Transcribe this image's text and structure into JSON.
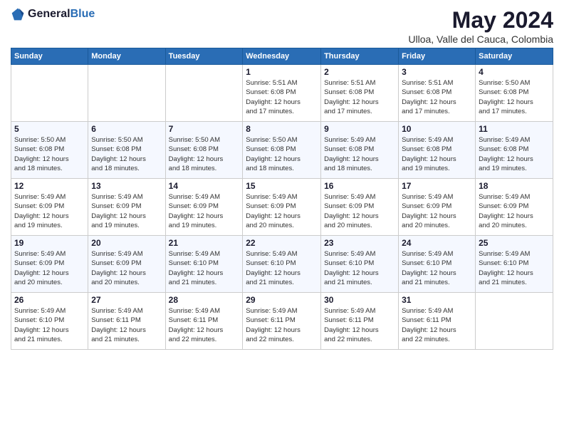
{
  "app": {
    "logo_general": "General",
    "logo_blue": "Blue",
    "title": "May 2024",
    "subtitle": "Ulloa, Valle del Cauca, Colombia"
  },
  "calendar": {
    "headers": [
      "Sunday",
      "Monday",
      "Tuesday",
      "Wednesday",
      "Thursday",
      "Friday",
      "Saturday"
    ],
    "rows": [
      [
        {
          "day": "",
          "info": ""
        },
        {
          "day": "",
          "info": ""
        },
        {
          "day": "",
          "info": ""
        },
        {
          "day": "1",
          "info": "Sunrise: 5:51 AM\nSunset: 6:08 PM\nDaylight: 12 hours\nand 17 minutes."
        },
        {
          "day": "2",
          "info": "Sunrise: 5:51 AM\nSunset: 6:08 PM\nDaylight: 12 hours\nand 17 minutes."
        },
        {
          "day": "3",
          "info": "Sunrise: 5:51 AM\nSunset: 6:08 PM\nDaylight: 12 hours\nand 17 minutes."
        },
        {
          "day": "4",
          "info": "Sunrise: 5:50 AM\nSunset: 6:08 PM\nDaylight: 12 hours\nand 17 minutes."
        }
      ],
      [
        {
          "day": "5",
          "info": "Sunrise: 5:50 AM\nSunset: 6:08 PM\nDaylight: 12 hours\nand 18 minutes."
        },
        {
          "day": "6",
          "info": "Sunrise: 5:50 AM\nSunset: 6:08 PM\nDaylight: 12 hours\nand 18 minutes."
        },
        {
          "day": "7",
          "info": "Sunrise: 5:50 AM\nSunset: 6:08 PM\nDaylight: 12 hours\nand 18 minutes."
        },
        {
          "day": "8",
          "info": "Sunrise: 5:50 AM\nSunset: 6:08 PM\nDaylight: 12 hours\nand 18 minutes."
        },
        {
          "day": "9",
          "info": "Sunrise: 5:49 AM\nSunset: 6:08 PM\nDaylight: 12 hours\nand 18 minutes."
        },
        {
          "day": "10",
          "info": "Sunrise: 5:49 AM\nSunset: 6:08 PM\nDaylight: 12 hours\nand 19 minutes."
        },
        {
          "day": "11",
          "info": "Sunrise: 5:49 AM\nSunset: 6:08 PM\nDaylight: 12 hours\nand 19 minutes."
        }
      ],
      [
        {
          "day": "12",
          "info": "Sunrise: 5:49 AM\nSunset: 6:09 PM\nDaylight: 12 hours\nand 19 minutes."
        },
        {
          "day": "13",
          "info": "Sunrise: 5:49 AM\nSunset: 6:09 PM\nDaylight: 12 hours\nand 19 minutes."
        },
        {
          "day": "14",
          "info": "Sunrise: 5:49 AM\nSunset: 6:09 PM\nDaylight: 12 hours\nand 19 minutes."
        },
        {
          "day": "15",
          "info": "Sunrise: 5:49 AM\nSunset: 6:09 PM\nDaylight: 12 hours\nand 20 minutes."
        },
        {
          "day": "16",
          "info": "Sunrise: 5:49 AM\nSunset: 6:09 PM\nDaylight: 12 hours\nand 20 minutes."
        },
        {
          "day": "17",
          "info": "Sunrise: 5:49 AM\nSunset: 6:09 PM\nDaylight: 12 hours\nand 20 minutes."
        },
        {
          "day": "18",
          "info": "Sunrise: 5:49 AM\nSunset: 6:09 PM\nDaylight: 12 hours\nand 20 minutes."
        }
      ],
      [
        {
          "day": "19",
          "info": "Sunrise: 5:49 AM\nSunset: 6:09 PM\nDaylight: 12 hours\nand 20 minutes."
        },
        {
          "day": "20",
          "info": "Sunrise: 5:49 AM\nSunset: 6:09 PM\nDaylight: 12 hours\nand 20 minutes."
        },
        {
          "day": "21",
          "info": "Sunrise: 5:49 AM\nSunset: 6:10 PM\nDaylight: 12 hours\nand 21 minutes."
        },
        {
          "day": "22",
          "info": "Sunrise: 5:49 AM\nSunset: 6:10 PM\nDaylight: 12 hours\nand 21 minutes."
        },
        {
          "day": "23",
          "info": "Sunrise: 5:49 AM\nSunset: 6:10 PM\nDaylight: 12 hours\nand 21 minutes."
        },
        {
          "day": "24",
          "info": "Sunrise: 5:49 AM\nSunset: 6:10 PM\nDaylight: 12 hours\nand 21 minutes."
        },
        {
          "day": "25",
          "info": "Sunrise: 5:49 AM\nSunset: 6:10 PM\nDaylight: 12 hours\nand 21 minutes."
        }
      ],
      [
        {
          "day": "26",
          "info": "Sunrise: 5:49 AM\nSunset: 6:10 PM\nDaylight: 12 hours\nand 21 minutes."
        },
        {
          "day": "27",
          "info": "Sunrise: 5:49 AM\nSunset: 6:11 PM\nDaylight: 12 hours\nand 21 minutes."
        },
        {
          "day": "28",
          "info": "Sunrise: 5:49 AM\nSunset: 6:11 PM\nDaylight: 12 hours\nand 22 minutes."
        },
        {
          "day": "29",
          "info": "Sunrise: 5:49 AM\nSunset: 6:11 PM\nDaylight: 12 hours\nand 22 minutes."
        },
        {
          "day": "30",
          "info": "Sunrise: 5:49 AM\nSunset: 6:11 PM\nDaylight: 12 hours\nand 22 minutes."
        },
        {
          "day": "31",
          "info": "Sunrise: 5:49 AM\nSunset: 6:11 PM\nDaylight: 12 hours\nand 22 minutes."
        },
        {
          "day": "",
          "info": ""
        }
      ]
    ]
  }
}
